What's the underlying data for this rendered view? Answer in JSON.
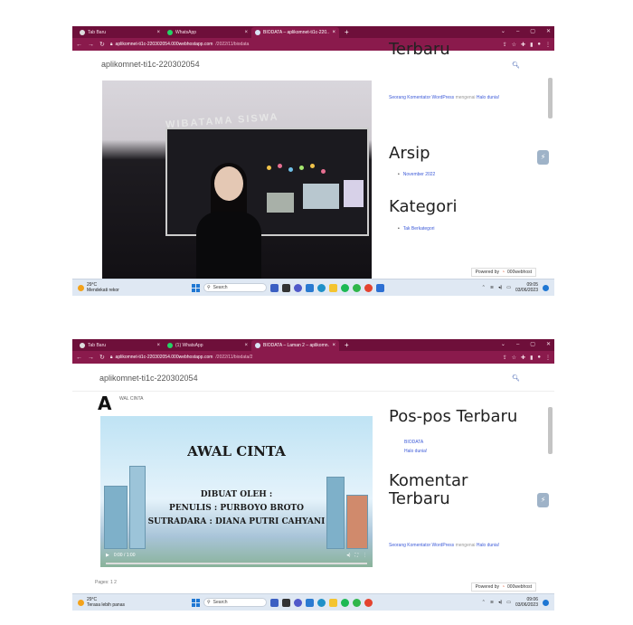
{
  "shot1": {
    "tabs": [
      {
        "label": "Tab Baru",
        "active": false
      },
      {
        "label": "WhatsApp",
        "active": false
      },
      {
        "label": "BIODATA – aplikomnet-ti1c-220...",
        "active": true
      }
    ],
    "url_host": "aplikomnet-ti1c-220302054.000webhostapp.com",
    "url_path": "/2022/11/biodata",
    "site_title": "aplikomnet-ti1c-220302054",
    "photo_board_text": "WIBATAMA SISWA",
    "heading_terbaru": "Terbaru",
    "comment_author": "Seorang Komentator WordPress",
    "comment_on": "mengenai",
    "comment_post": "Halo dunia!",
    "heading_arsip": "Arsip",
    "arsip_item": "November 2022",
    "heading_kategori": "Kategori",
    "kategori_item": "Tak Berkategori",
    "powered": "Powered by",
    "powered_brand": "000webhost",
    "taskbar": {
      "temp": "29°C",
      "weather": "Mendekati rekor",
      "search": "Search",
      "time": "09:05",
      "date": "03/06/2023"
    }
  },
  "shot2": {
    "tabs": [
      {
        "label": "Tab Baru",
        "active": false
      },
      {
        "label": "(1) WhatsApp",
        "active": false
      },
      {
        "label": "BIODATA – Laman 2 – aplikomn...",
        "active": true
      }
    ],
    "url_host": "aplikomnet-ti1c-220302054.000webhostapp.com",
    "url_path": "/2022/11/biodata/2",
    "site_title": "aplikomnet-ti1c-220302054",
    "big_letter": "A",
    "small_label": "WAL CINTA",
    "video_title": "AWAL CINTA",
    "video_line1": "DIBUAT OLEH :",
    "video_line2": "PENULIS : PURBOYO BROTO",
    "video_line3": "SUTRADARA : DIANA PUTRI CAHYANI",
    "video_time": "0:00 / 1:00",
    "pages_label": "Pages: 1 2",
    "heading_pospos": "Pos-pos Terbaru",
    "pospos_items": [
      "BIODATA",
      "Halo dunia!"
    ],
    "heading_komentar1": "Komentar",
    "heading_komentar2": "Terbaru",
    "comment_author": "Seorang Komentator WordPress",
    "comment_on": "mengenai",
    "comment_post": "Halo dunia!",
    "powered": "Powered by",
    "powered_brand": "000webhost",
    "taskbar": {
      "temp": "29°C",
      "weather": "Terasa lebih panas",
      "search": "Search",
      "time": "09:06",
      "date": "03/06/2023"
    }
  },
  "colors": {
    "tabbar": "#6e0f3a",
    "addressbar": "#8a1a4c",
    "link": "#3d5bd8"
  }
}
